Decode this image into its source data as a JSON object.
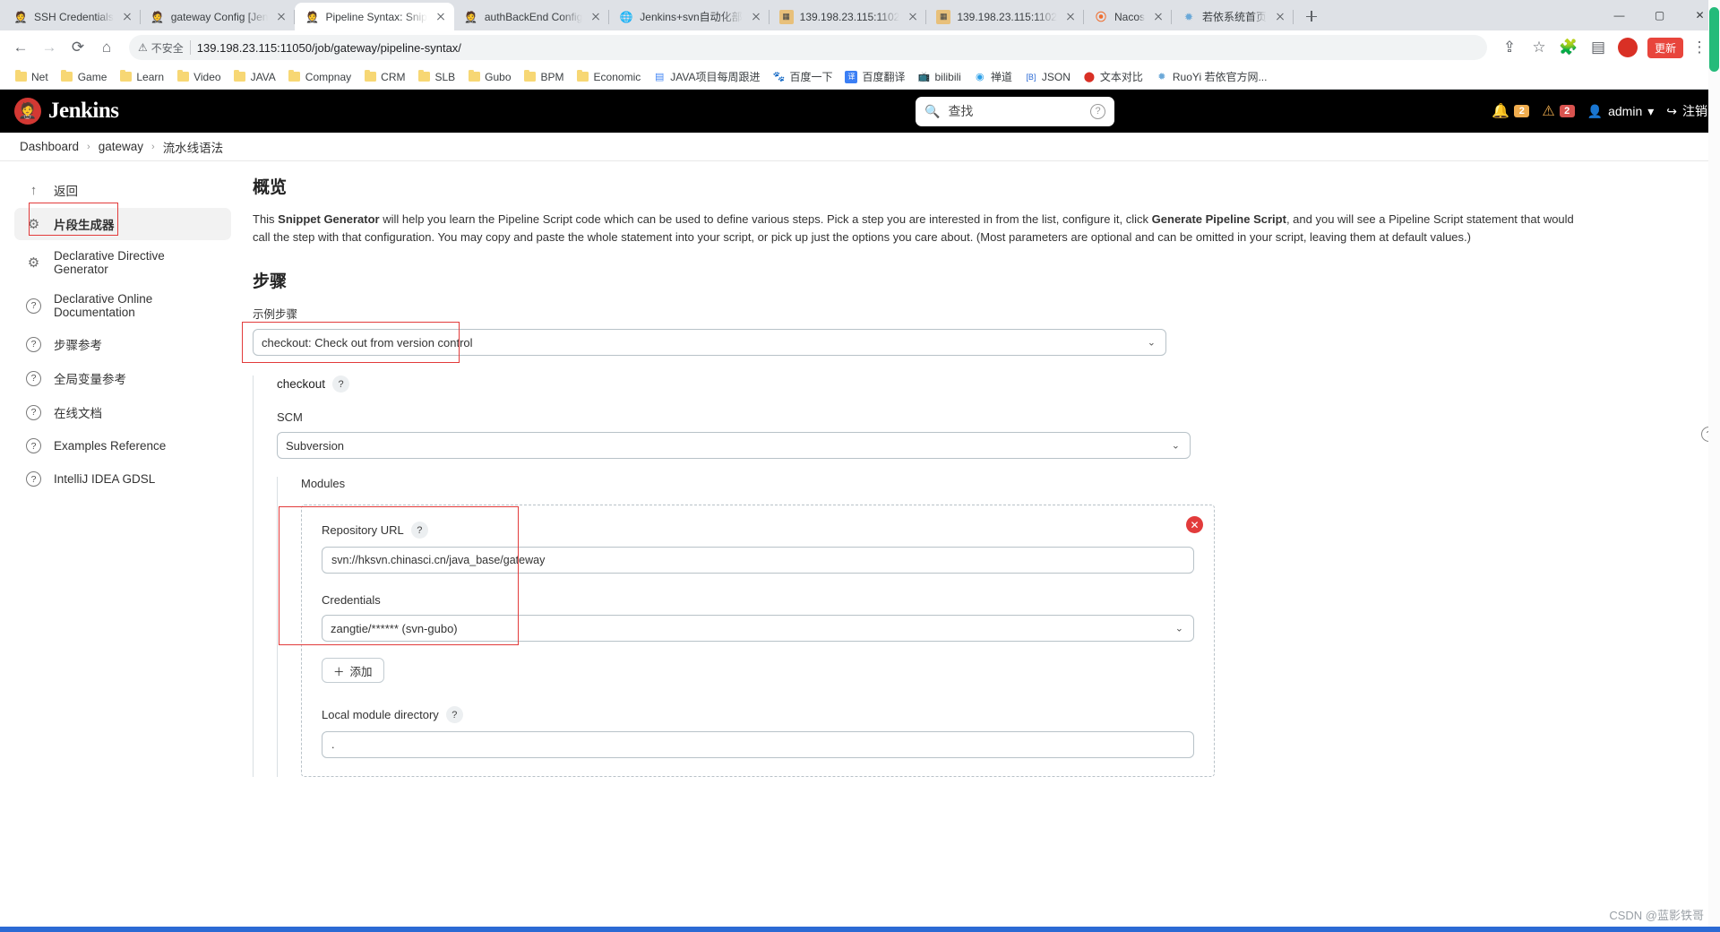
{
  "browser": {
    "tabs": [
      {
        "title": "SSH Credentials",
        "icon": "jenkins-favicon",
        "active": false
      },
      {
        "title": "gateway Config [Jen",
        "icon": "jenkins-favicon",
        "active": false
      },
      {
        "title": "Pipeline Syntax: Snip",
        "icon": "jenkins-favicon",
        "active": true
      },
      {
        "title": "authBackEnd Config",
        "icon": "jenkins-favicon",
        "active": false
      },
      {
        "title": "Jenkins+svn自动化部",
        "icon": "globe-favicon",
        "active": false
      },
      {
        "title": "139.198.23.115:1102",
        "icon": "app-favicon",
        "active": false
      },
      {
        "title": "139.198.23.115:1102",
        "icon": "app-favicon",
        "active": false
      },
      {
        "title": "Nacos",
        "icon": "nacos-favicon",
        "active": false
      },
      {
        "title": "若依系统首页",
        "icon": "ruoyi-favicon",
        "active": false
      }
    ],
    "new_tab_label": "+",
    "window_controls": [
      "minimize",
      "maximize",
      "close"
    ],
    "nav": {
      "back": "back-arrow",
      "forward": "forward-arrow",
      "reload": "reload",
      "home": "home",
      "security_warning": "不安全",
      "url": "139.198.23.115:11050/job/gateway/pipeline-syntax/",
      "share": "share-icon",
      "bookmark_star": "star-icon",
      "extensions": "puzzle-icon",
      "sidepanel": "sidepanel-icon",
      "profile": "profile-avatar",
      "update_label": "更新",
      "menu": "kebab-menu"
    },
    "bookmarks": [
      {
        "label": "Net",
        "icon": "folder-icon"
      },
      {
        "label": "Game",
        "icon": "folder-icon"
      },
      {
        "label": "Learn",
        "icon": "folder-icon"
      },
      {
        "label": "Video",
        "icon": "folder-icon"
      },
      {
        "label": "JAVA",
        "icon": "folder-icon"
      },
      {
        "label": "Compnay",
        "icon": "folder-icon"
      },
      {
        "label": "CRM",
        "icon": "folder-icon"
      },
      {
        "label": "SLB",
        "icon": "folder-icon"
      },
      {
        "label": "Gubo",
        "icon": "folder-icon"
      },
      {
        "label": "BPM",
        "icon": "folder-icon"
      },
      {
        "label": "Economic",
        "icon": "folder-icon"
      },
      {
        "label": "JAVA项目每周跟进",
        "icon": "doc-icon"
      },
      {
        "label": "百度一下",
        "icon": "baidu-icon"
      },
      {
        "label": "百度翻译",
        "icon": "fanyi-icon"
      },
      {
        "label": "bilibili",
        "icon": "bilibili-icon"
      },
      {
        "label": "禅道",
        "icon": "zentao-icon"
      },
      {
        "label": "JSON",
        "icon": "json-icon"
      },
      {
        "label": "文本对比",
        "icon": "diff-icon"
      },
      {
        "label": "RuoYi 若依官方网...",
        "icon": "ruoyi-icon"
      }
    ]
  },
  "jenkins": {
    "brand": "Jenkins",
    "search": {
      "placeholder": "查找",
      "icon": "search-icon",
      "help": "?"
    },
    "notifications": {
      "bell_icon": "bell-icon",
      "bell_count": "2",
      "warn_icon": "warning-icon",
      "warn_count": "2"
    },
    "user": {
      "name": "admin",
      "icon": "person-icon",
      "caret": "▾"
    },
    "logout": {
      "label": "注销",
      "icon": "logout-icon"
    },
    "breadcrumb": [
      {
        "label": "Dashboard"
      },
      {
        "label": "gateway"
      },
      {
        "label": "流水线语法"
      }
    ],
    "breadcrumb_separator": "›",
    "sidebar": [
      {
        "label": "返回",
        "icon": "up-arrow-icon",
        "selected": false,
        "highlighted": false
      },
      {
        "label": "片段生成器",
        "icon": "gear-icon",
        "selected": true,
        "highlighted": true
      },
      {
        "label": "Declarative Directive Generator",
        "icon": "gear-icon",
        "selected": false,
        "highlighted": false
      },
      {
        "label": "Declarative Online Documentation",
        "icon": "question-icon",
        "selected": false,
        "highlighted": false
      },
      {
        "label": "步骤参考",
        "icon": "question-icon",
        "selected": false,
        "highlighted": false
      },
      {
        "label": "全局变量参考",
        "icon": "question-icon",
        "selected": false,
        "highlighted": false
      },
      {
        "label": "在线文档",
        "icon": "question-icon",
        "selected": false,
        "highlighted": false
      },
      {
        "label": "Examples Reference",
        "icon": "question-icon",
        "selected": false,
        "highlighted": false
      },
      {
        "label": "IntelliJ IDEA GDSL",
        "icon": "question-icon",
        "selected": false,
        "highlighted": false
      }
    ],
    "main": {
      "overview_title": "概览",
      "overview_text_1": "This ",
      "overview_bold_1": "Snippet Generator",
      "overview_text_2": " will help you learn the Pipeline Script code which can be used to define various steps. Pick a step you are interested in from the list, configure it, click ",
      "overview_bold_2": "Generate Pipeline Script",
      "overview_text_3": ", and you will see a Pipeline Script statement that would call the step with that configuration. You may copy and paste the whole statement into your script, or pick up just the options you care about. (Most parameters are optional and can be omitted in your script, leaving them at default values.)",
      "steps_title": "步骤",
      "sample_step_label": "示例步骤",
      "sample_step_value": "checkout: Check out from version control",
      "step_panel_title": "checkout",
      "step_panel_help": "?",
      "scm_label": "SCM",
      "scm_value": "Subversion",
      "modules_label": "Modules",
      "repository_url_label": "Repository URL",
      "repository_url_help": "?",
      "repository_url_value": "svn://hksvn.chinasci.cn/java_base/gateway",
      "credentials_label": "Credentials",
      "credentials_value": "zangtie/****** (svn-gubo)",
      "add_button_label": "添加",
      "add_button_icon": "plus-icon",
      "local_module_directory_label": "Local module directory",
      "local_module_directory_help": "?",
      "local_module_directory_value": ".",
      "delete_icon": "close-icon",
      "side_help": "?"
    },
    "highlight_color": "#e23b3b"
  },
  "watermark": "CSDN @蓝影铁哥"
}
